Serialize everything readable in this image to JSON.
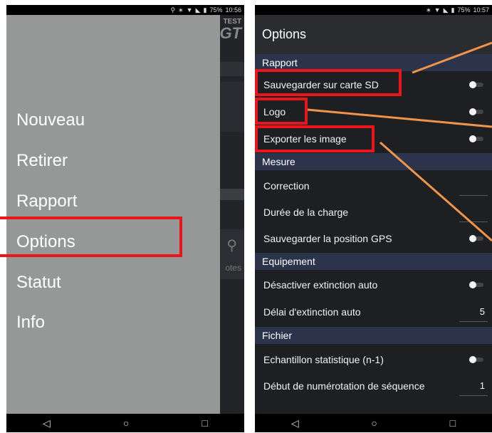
{
  "left_phone": {
    "status": {
      "battery": "75%",
      "time": "10:56"
    },
    "background_logo": {
      "line1": "TEST",
      "line2": "GT"
    },
    "background_text": "otes",
    "menu": [
      "Nouveau",
      "Retirer",
      "Rapport",
      "Options",
      "Statut",
      "Info"
    ],
    "highlighted_item": "Options",
    "nav": {
      "back": "◁",
      "home": "○",
      "recent": "□"
    }
  },
  "right_phone": {
    "status": {
      "battery": "75%",
      "time": "10:57"
    },
    "title": "Options",
    "sections": [
      {
        "header": "Rapport",
        "rows": [
          {
            "label": "Sauvegarder sur carte SD",
            "type": "toggle",
            "on": false
          },
          {
            "label": "Logo",
            "type": "toggle",
            "on": false
          },
          {
            "label": "Exporter les image",
            "type": "toggle",
            "on": false
          }
        ]
      },
      {
        "header": "Mesure",
        "rows": [
          {
            "label": "Correction",
            "type": "value",
            "value": ""
          },
          {
            "label": "Durée de la charge",
            "type": "value",
            "value": ""
          },
          {
            "label": "Sauvegarder la position GPS",
            "type": "toggle",
            "on": false
          }
        ]
      },
      {
        "header": "Equipement",
        "rows": [
          {
            "label": "Désactiver extinction auto",
            "type": "toggle",
            "on": false
          },
          {
            "label": "Délai d'extinction auto",
            "type": "value",
            "value": "5"
          }
        ]
      },
      {
        "header": "Fichier",
        "rows": [
          {
            "label": "Echantillon statistique (n-1)",
            "type": "toggle",
            "on": false
          },
          {
            "label": "Début de numérotation de séquence",
            "type": "value",
            "value": "1"
          }
        ]
      }
    ],
    "nav": {
      "back": "◁",
      "home": "○",
      "recent": "□"
    }
  },
  "colors": {
    "highlight": "#e8151b",
    "arrow": "#f0944a",
    "drawer": "#969897",
    "section": "#2c344b"
  }
}
